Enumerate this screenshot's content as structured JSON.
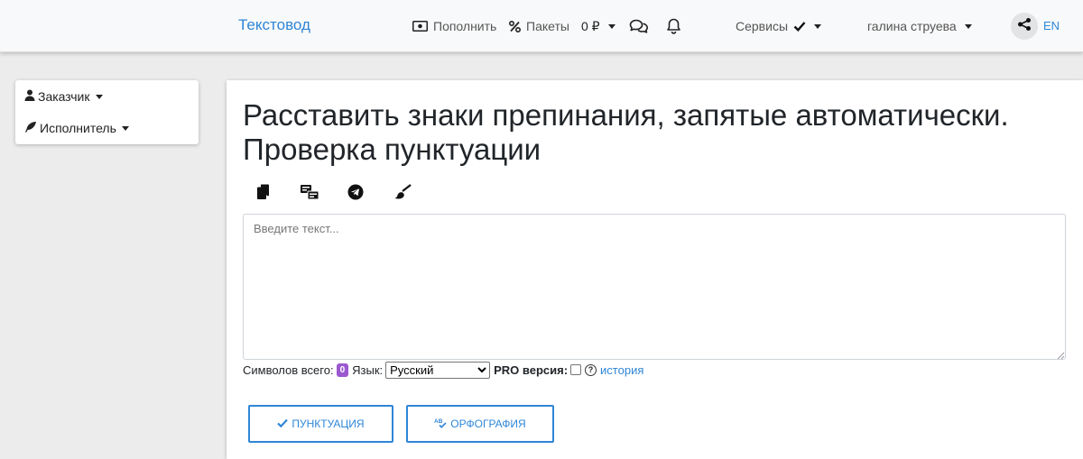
{
  "navbar": {
    "brand": "Текстовод",
    "topup_label": "Пополнить",
    "packages_label": "Пакеты",
    "balance": "0 ₽",
    "services_label": "Сервисы",
    "user_name": "галина струева",
    "language": "EN"
  },
  "sidebar": {
    "items": [
      {
        "label": "Заказчик",
        "icon": "user-icon"
      },
      {
        "label": "Исполнитель",
        "icon": "feather-icon"
      }
    ]
  },
  "main": {
    "title": "Расставить знаки препинания, запятые автоматически. Проверка пунктуации",
    "toolbar_icons": [
      "copy-icon",
      "paste-translate-icon",
      "telegram-icon",
      "clear-brush-icon"
    ],
    "textarea_placeholder": "Введите текст...",
    "stats": {
      "chars_label": "Символов всего:",
      "chars_count": "0",
      "language_label": "Язык:",
      "language_selected": "Русский",
      "pro_label": "PRO версия:",
      "history_link": "история"
    },
    "buttons": {
      "punctuation": "ПУНКТУАЦИЯ",
      "spelling": "ОРФОГРАФИЯ"
    }
  },
  "colors": {
    "accent": "#2f86d6",
    "badge": "#9b59d0",
    "background": "#ececec",
    "navbar": "#f8f9fa"
  }
}
